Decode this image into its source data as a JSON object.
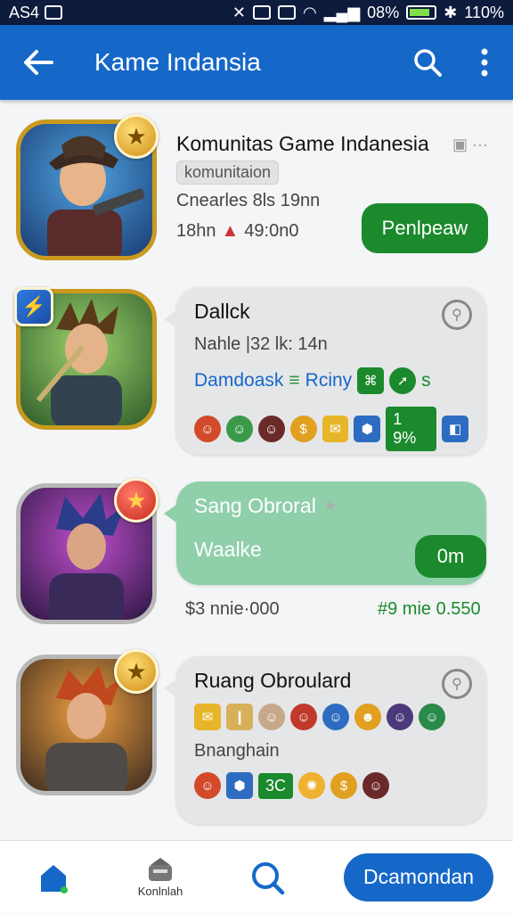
{
  "status": {
    "left_text": "AS4",
    "battery_pct": "08%",
    "signal_text": "110%"
  },
  "appbar": {
    "title": "Kame Indansia",
    "back_icon": "back-arrow-icon",
    "search_icon": "search-icon",
    "more_icon": "more-vert-icon"
  },
  "cards": [
    {
      "title": "Komunitas Game Indanesia",
      "tag": "komunitaion",
      "line1": "Cnearles 8ls 19nn",
      "line2": "18hn",
      "line2b": "49:0n0",
      "button": "Penlpeaw"
    },
    {
      "title": "Dallck",
      "line1": "Nahle |32 lk: 14n",
      "line2": "Damdoask",
      "line2b": "Rciny",
      "line2c": "s",
      "chip": "1 9%"
    },
    {
      "title": "Sang Obroral",
      "line1": "Waalke",
      "button": "0m",
      "foot_left": "$3 nnie·000",
      "foot_right": "#9 mie 0.550"
    },
    {
      "title": "Ruang Obroulard",
      "line1": "Bnanghain",
      "chip": "3C"
    }
  ],
  "bottom_nav": {
    "item2_label": "Konlnlah",
    "cta": "Dcamondan"
  },
  "colors": {
    "accent": "#1668c8",
    "green": "#1a8a2c",
    "gold": "#c99a1e"
  }
}
